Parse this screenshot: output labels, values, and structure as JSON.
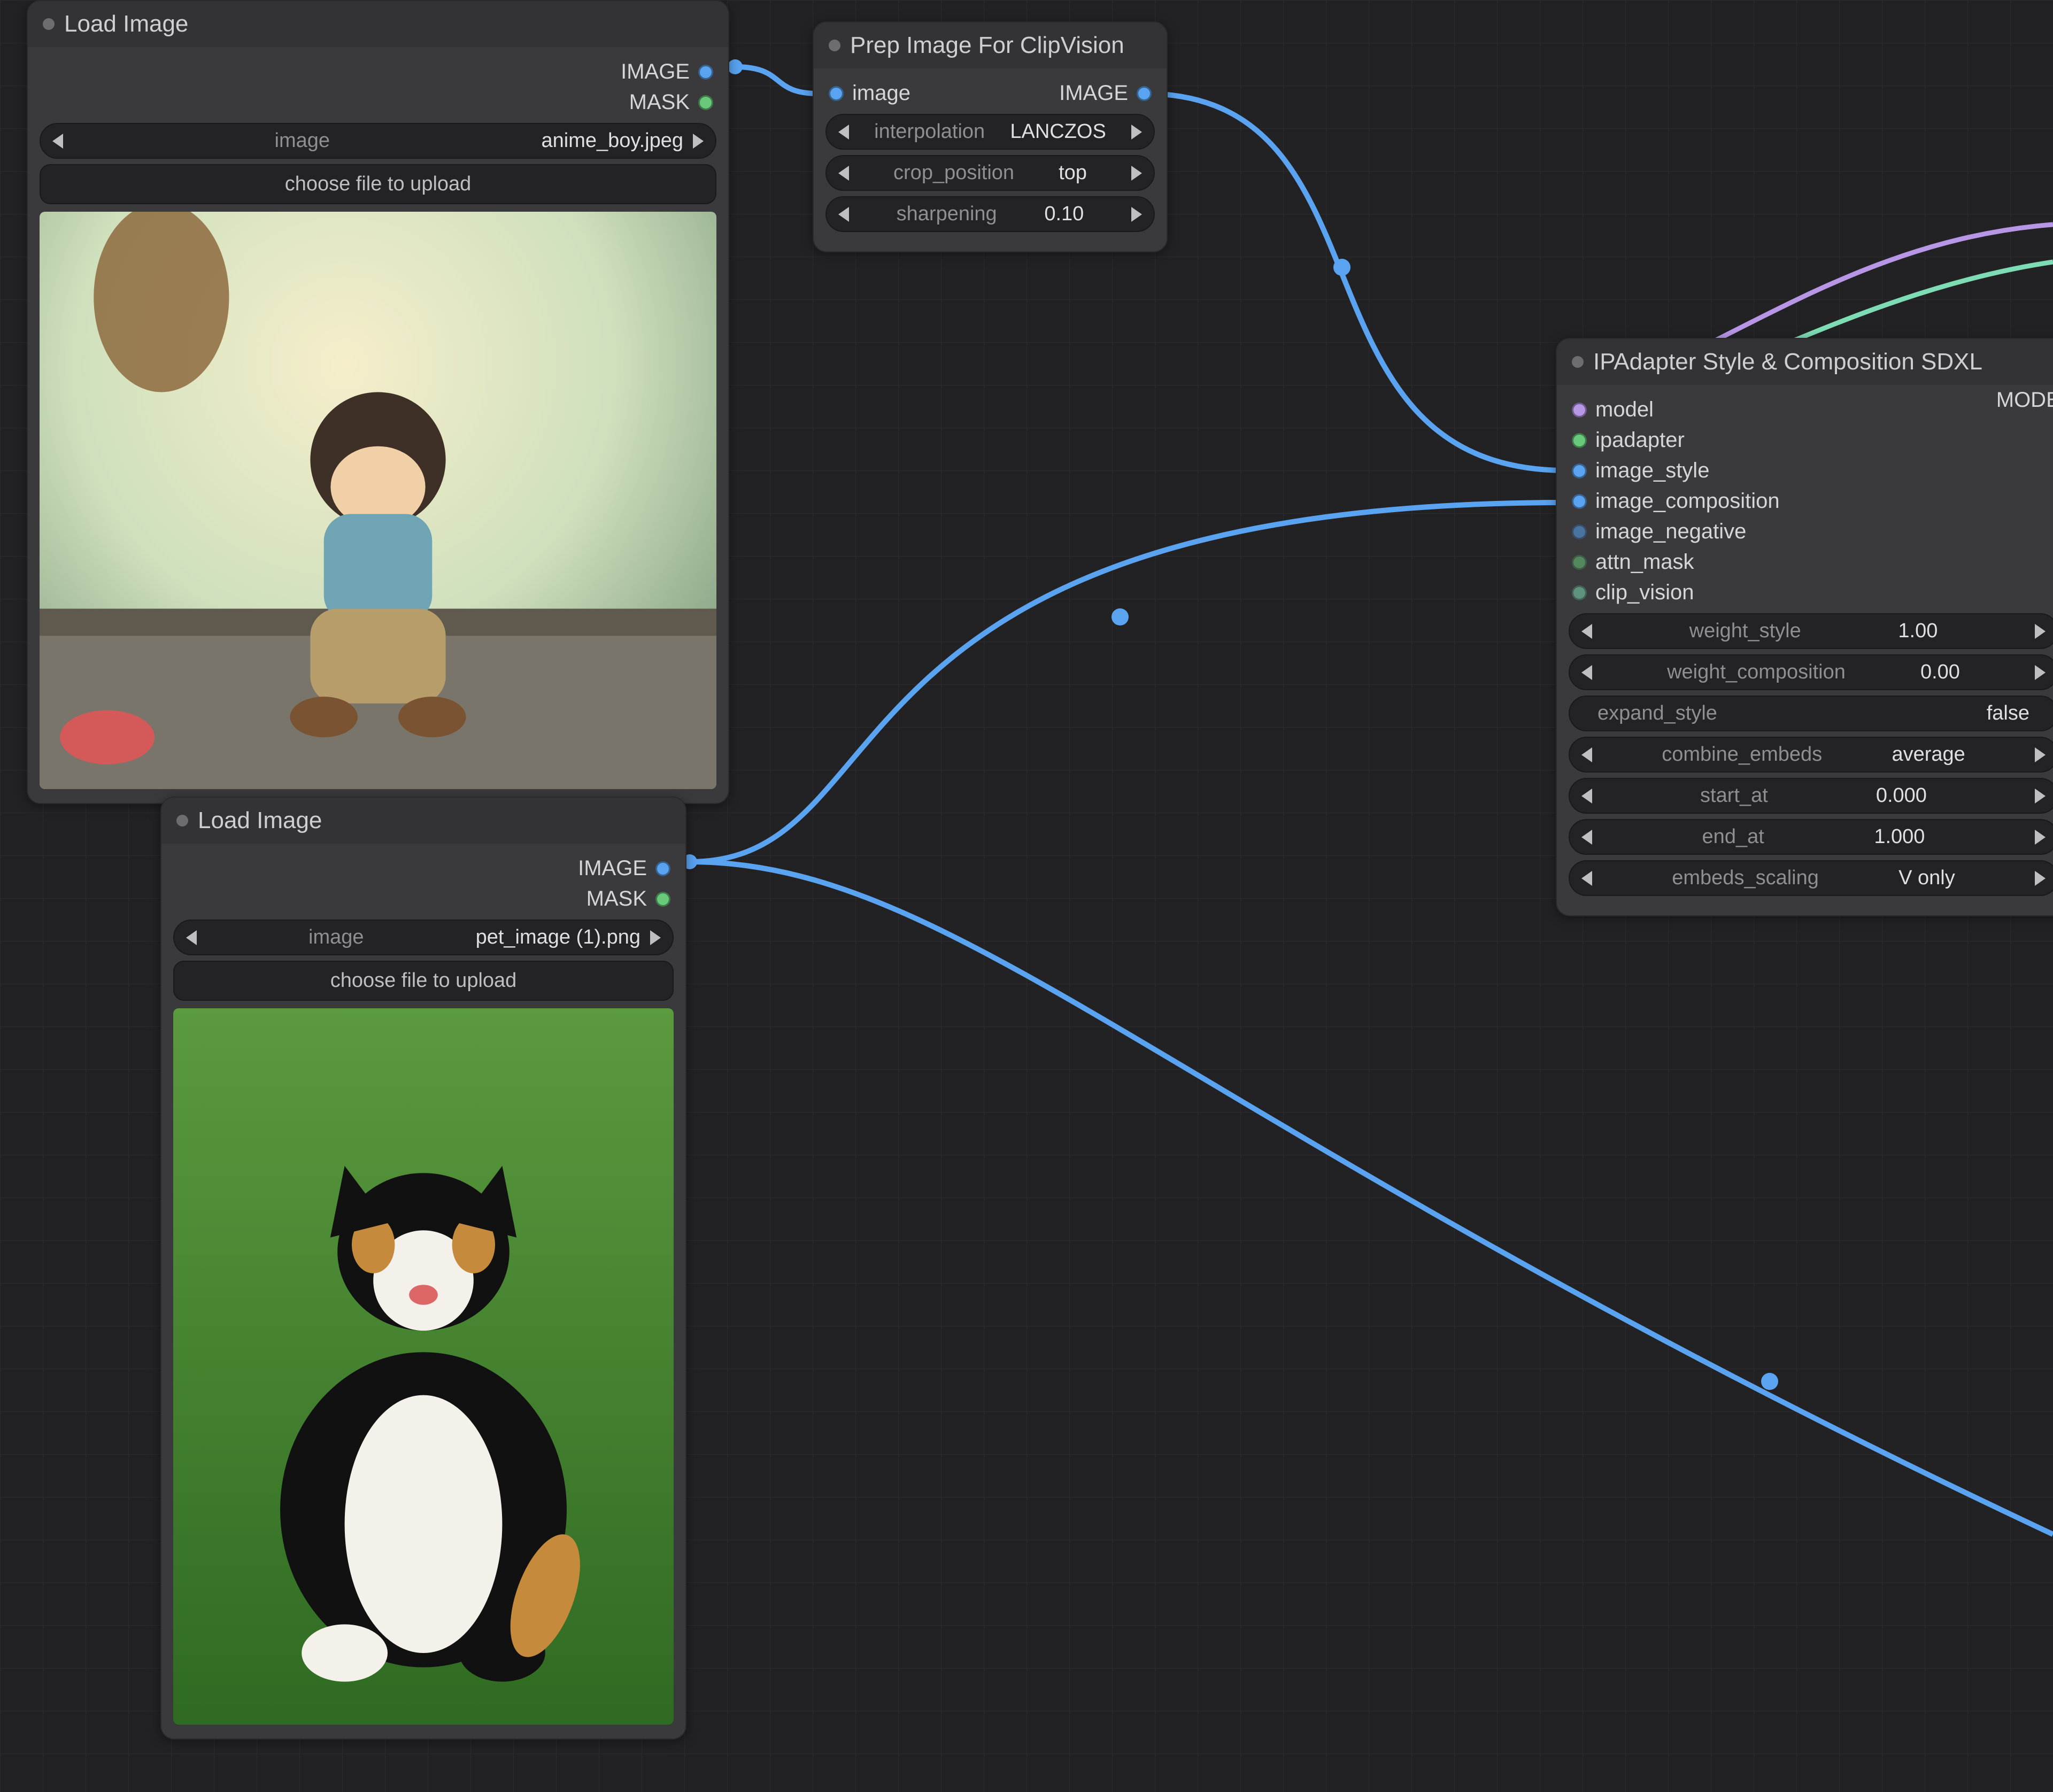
{
  "nodes": {
    "load1": {
      "title": "Load Image",
      "out_image": "IMAGE",
      "out_mask": "MASK",
      "image_param": "image",
      "image_value": "anime_boy.jpeg",
      "upload": "choose file to upload"
    },
    "load2": {
      "title": "Load Image",
      "out_image": "IMAGE",
      "out_mask": "MASK",
      "image_param": "image",
      "image_value": "pet_image (1).png",
      "upload": "choose file to upload"
    },
    "prep": {
      "title": "Prep Image For ClipVision",
      "in_image": "image",
      "out_image": "IMAGE",
      "interpolation_label": "interpolation",
      "interpolation_value": "LANCZOS",
      "crop_label": "crop_position",
      "crop_value": "top",
      "sharpen_label": "sharpening",
      "sharpen_value": "0.10"
    },
    "ipadapter": {
      "title": "IPAdapter Style & Composition SDXL",
      "in_model": "model",
      "in_ipadapter": "ipadapter",
      "in_image_style": "image_style",
      "in_image_comp": "image_composition",
      "in_image_neg": "image_negative",
      "in_attn_mask": "attn_mask",
      "in_clip_vision": "clip_vision",
      "out_model": "MODEL",
      "w_style_lbl": "weight_style",
      "w_style_val": "1.00",
      "w_comp_lbl": "weight_composition",
      "w_comp_val": "0.00",
      "expand_lbl": "expand_style",
      "expand_val": "false",
      "combine_lbl": "combine_embeds",
      "combine_val": "average",
      "start_lbl": "start_at",
      "start_val": "0.000",
      "end_lbl": "end_at",
      "end_val": "1.000",
      "scale_lbl": "embeds_scaling",
      "scale_val": "V only"
    }
  },
  "colors": {
    "blue": "#5aa3f0",
    "green": "#69c97b",
    "purple": "#b896e6",
    "mint": "#7ddcb3"
  }
}
